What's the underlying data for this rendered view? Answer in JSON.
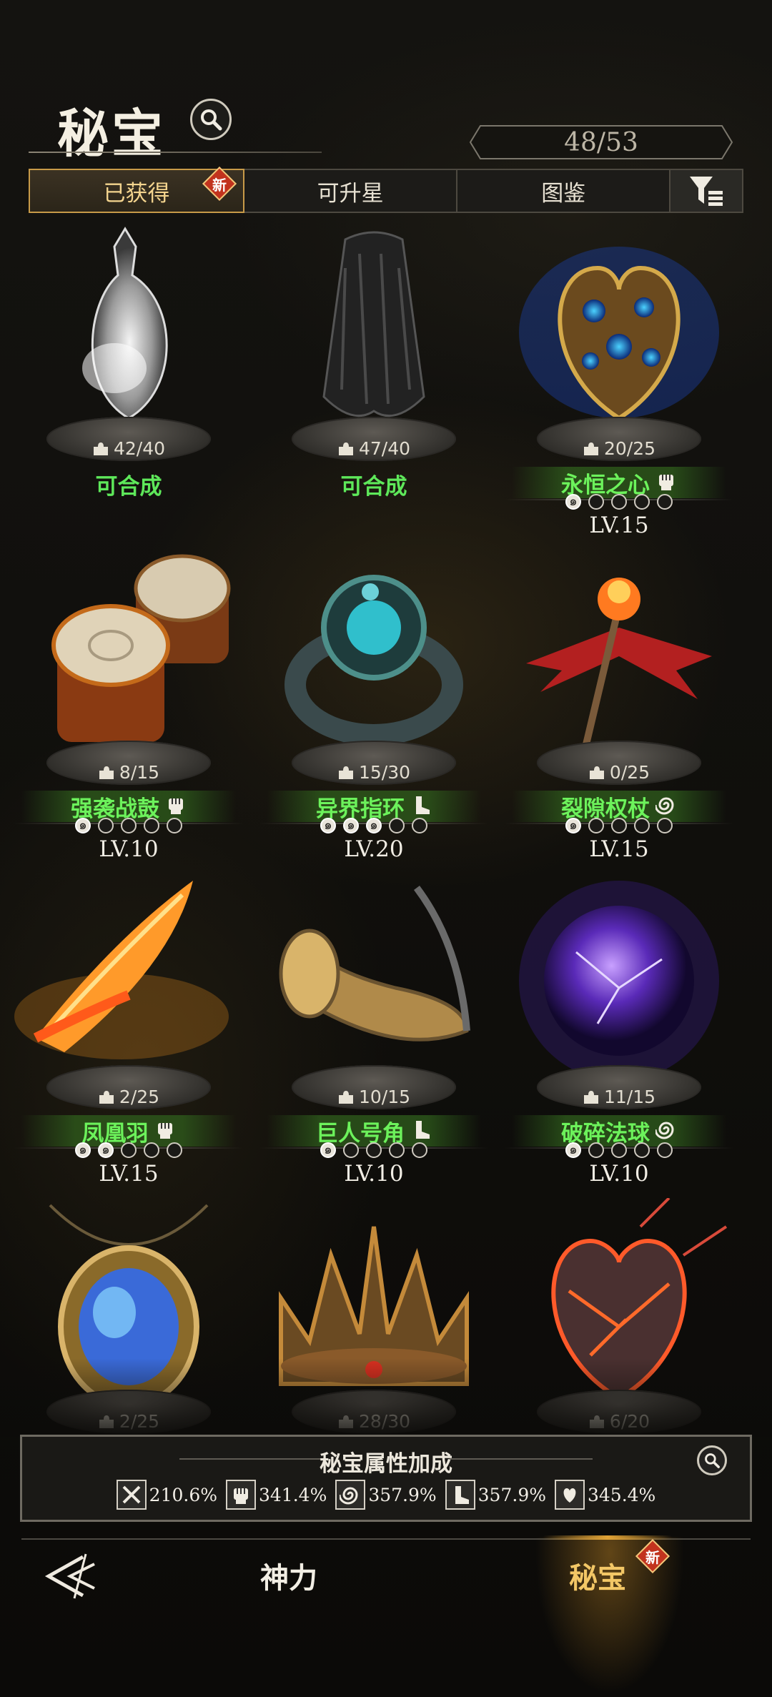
{
  "header": {
    "title": "秘宝",
    "counter": "48/53"
  },
  "tabs": [
    {
      "label": "已获得",
      "badge": "新"
    },
    {
      "label": "可升星"
    },
    {
      "label": "图鉴"
    }
  ],
  "items": [
    {
      "name": "",
      "fragments": "42/40",
      "status": "可合成",
      "art": "potion-bottle"
    },
    {
      "name": "",
      "fragments": "47/40",
      "status": "可合成",
      "art": "dark-cloak"
    },
    {
      "name": "永恒之心",
      "fragments": "20/25",
      "level": "LV.15",
      "stars": 1,
      "type_icon": "fist-icon",
      "art": "jeweled-heart"
    },
    {
      "name": "强袭战鼓",
      "fragments": "8/15",
      "level": "LV.10",
      "stars": 1,
      "type_icon": "fist-icon",
      "art": "war-drums"
    },
    {
      "name": "异界指环",
      "fragments": "15/30",
      "level": "LV.20",
      "stars": 3,
      "type_icon": "boot-icon",
      "art": "ring"
    },
    {
      "name": "裂隙权杖",
      "fragments": "0/25",
      "level": "LV.15",
      "stars": 1,
      "type_icon": "swirl-icon",
      "art": "winged-scepter"
    },
    {
      "name": "凤凰羽",
      "fragments": "2/25",
      "level": "LV.15",
      "stars": 2,
      "type_icon": "fist-icon",
      "art": "phoenix-feather"
    },
    {
      "name": "巨人号角",
      "fragments": "10/15",
      "level": "LV.10",
      "stars": 1,
      "type_icon": "boot-icon",
      "art": "horn"
    },
    {
      "name": "破碎法球",
      "fragments": "11/15",
      "level": "LV.10",
      "stars": 1,
      "type_icon": "swirl-icon",
      "art": "arcane-orb"
    },
    {
      "name": "",
      "fragments": "2/25",
      "art": "amulet"
    },
    {
      "name": "",
      "fragments": "28/30",
      "art": "crown"
    },
    {
      "name": "",
      "fragments": "6/20",
      "art": "burning-heart"
    }
  ],
  "bonus": {
    "title": "秘宝属性加成",
    "stats": [
      {
        "icon": "sword-icon",
        "value": "210.6%"
      },
      {
        "icon": "fist-icon",
        "value": "341.4%"
      },
      {
        "icon": "swirl-icon",
        "value": "357.9%"
      },
      {
        "icon": "boot-icon",
        "value": "357.9%"
      },
      {
        "icon": "heart-hand-icon",
        "value": "345.4%"
      }
    ]
  },
  "nav": {
    "item1": "神力",
    "item2": "秘宝",
    "item2_badge": "新"
  },
  "colors": {
    "accent_gold": "#c79a48",
    "name_green": "#6cf25b",
    "status_green": "#5ee85a"
  }
}
